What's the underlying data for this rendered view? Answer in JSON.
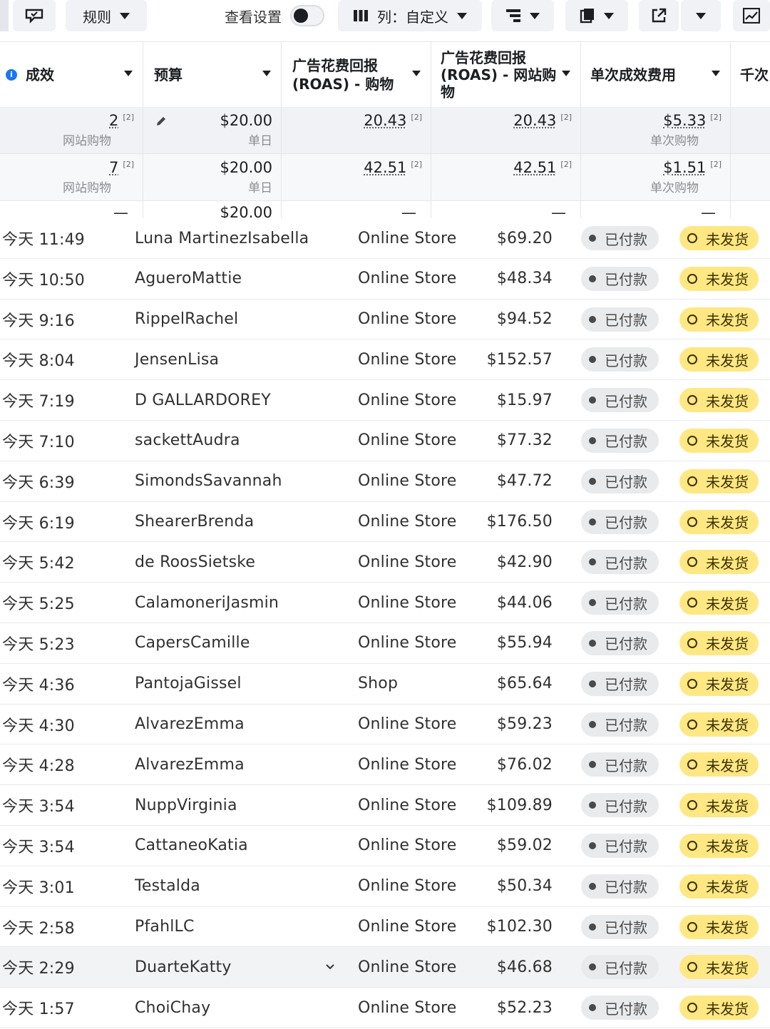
{
  "toolbar": {
    "rules_label": "规则",
    "view_settings_label": "查看设置",
    "columns_label": "列：自定义"
  },
  "ad_table": {
    "headers": [
      "成效",
      "预算",
      "广告花费回报\n(ROAS) - 购物",
      "广告花费回报\n(ROAS) - 网站购\n物",
      "单次成效费用",
      "千次"
    ],
    "rows": [
      {
        "results": "2",
        "results_sub": "网站购物",
        "budget": "$20.00",
        "budget_sub": "单日",
        "roas_purchase": "20.43",
        "roas_web": "20.43",
        "cpr": "$5.33",
        "cpr_sub": "单次购物"
      },
      {
        "results": "7",
        "results_sub": "网站购物",
        "budget": "$20.00",
        "budget_sub": "单日",
        "roas_purchase": "42.51",
        "roas_web": "42.51",
        "cpr": "$1.51",
        "cpr_sub": "单次购物"
      },
      {
        "results": "—",
        "results_sub": "",
        "budget": "$20.00",
        "budget_sub": "",
        "roas_purchase": "—",
        "roas_web": "—",
        "cpr": "—",
        "cpr_sub": ""
      }
    ],
    "footnote_mark": "[2]"
  },
  "orders": [
    {
      "time": "今天 11:49",
      "customer": "Luna MartinezIsabella",
      "channel": "Online Store",
      "amount": "$69.20",
      "payment": "已付款",
      "fulfillment": "未发货"
    },
    {
      "time": "今天 10:50",
      "customer": "AgueroMattie",
      "channel": "Online Store",
      "amount": "$48.34",
      "payment": "已付款",
      "fulfillment": "未发货"
    },
    {
      "time": "今天 9:16",
      "customer": "RippelRachel",
      "channel": "Online Store",
      "amount": "$94.52",
      "payment": "已付款",
      "fulfillment": "未发货"
    },
    {
      "time": "今天 8:04",
      "customer": "JensenLisa",
      "channel": "Online Store",
      "amount": "$152.57",
      "payment": "已付款",
      "fulfillment": "未发货"
    },
    {
      "time": "今天 7:19",
      "customer": "D GALLARDOREY",
      "channel": "Online Store",
      "amount": "$15.97",
      "payment": "已付款",
      "fulfillment": "未发货"
    },
    {
      "time": "今天 7:10",
      "customer": "sackettAudra",
      "channel": "Online Store",
      "amount": "$77.32",
      "payment": "已付款",
      "fulfillment": "未发货"
    },
    {
      "time": "今天 6:39",
      "customer": "SimondsSavannah",
      "channel": "Online Store",
      "amount": "$47.72",
      "payment": "已付款",
      "fulfillment": "未发货"
    },
    {
      "time": "今天 6:19",
      "customer": "ShearerBrenda",
      "channel": "Online Store",
      "amount": "$176.50",
      "payment": "已付款",
      "fulfillment": "未发货"
    },
    {
      "time": "今天 5:42",
      "customer": "de RoosSietske",
      "channel": "Online Store",
      "amount": "$42.90",
      "payment": "已付款",
      "fulfillment": "未发货"
    },
    {
      "time": "今天 5:25",
      "customer": "CalamoneriJasmin",
      "channel": "Online Store",
      "amount": "$44.06",
      "payment": "已付款",
      "fulfillment": "未发货"
    },
    {
      "time": "今天 5:23",
      "customer": "CapersCamille",
      "channel": "Online Store",
      "amount": "$55.94",
      "payment": "已付款",
      "fulfillment": "未发货"
    },
    {
      "time": "今天 4:36",
      "customer": "PantojaGissel",
      "channel": "Shop",
      "amount": "$65.64",
      "payment": "已付款",
      "fulfillment": "未发货"
    },
    {
      "time": "今天 4:30",
      "customer": "AlvarezEmma",
      "channel": "Online Store",
      "amount": "$59.23",
      "payment": "已付款",
      "fulfillment": "未发货"
    },
    {
      "time": "今天 4:28",
      "customer": "AlvarezEmma",
      "channel": "Online Store",
      "amount": "$76.02",
      "payment": "已付款",
      "fulfillment": "未发货"
    },
    {
      "time": "今天 3:54",
      "customer": "NuppVirginia",
      "channel": "Online Store",
      "amount": "$109.89",
      "payment": "已付款",
      "fulfillment": "未发货"
    },
    {
      "time": "今天 3:54",
      "customer": "CattaneoKatia",
      "channel": "Online Store",
      "amount": "$59.02",
      "payment": "已付款",
      "fulfillment": "未发货"
    },
    {
      "time": "今天 3:01",
      "customer": "Testalda",
      "channel": "Online Store",
      "amount": "$50.34",
      "payment": "已付款",
      "fulfillment": "未发货"
    },
    {
      "time": "今天 2:58",
      "customer": "PfahlLC",
      "channel": "Online Store",
      "amount": "$102.30",
      "payment": "已付款",
      "fulfillment": "未发货"
    },
    {
      "time": "今天 2:29",
      "customer": "DuarteKatty",
      "channel": "Online Store",
      "amount": "$46.68",
      "payment": "已付款",
      "fulfillment": "未发货",
      "highlighted": true
    },
    {
      "time": "今天 1:57",
      "customer": "ChoiChay",
      "channel": "Online Store",
      "amount": "$52.23",
      "payment": "已付款",
      "fulfillment": "未发货"
    }
  ],
  "colors": {
    "unfulfilled_badge": "#ffe783",
    "paid_badge": "#e9eaec",
    "info_icon": "#1877f2"
  }
}
